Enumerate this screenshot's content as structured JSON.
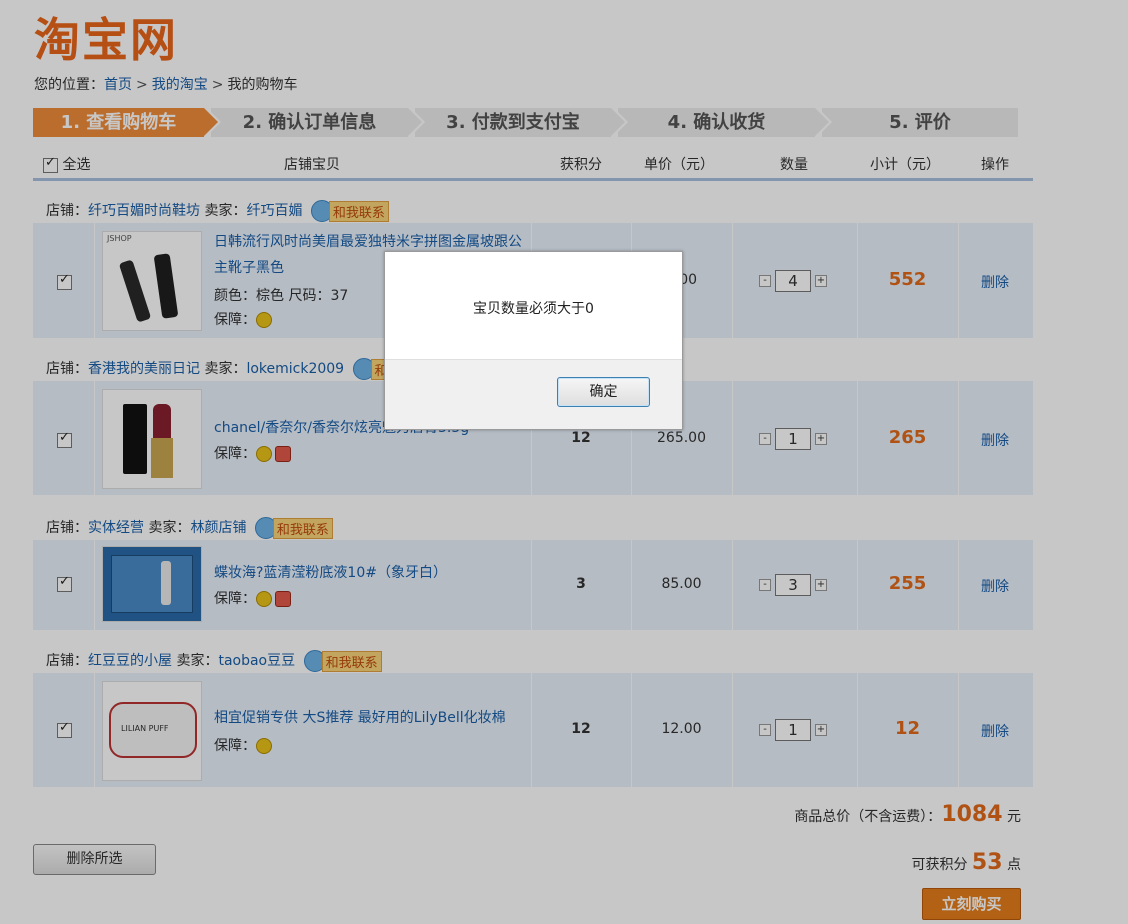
{
  "logo": "淘宝网",
  "breadcrumb": {
    "prefix": "您的位置：",
    "home": "首页",
    "my_taobao": "我的淘宝",
    "current": "我的购物车",
    "sep": ">"
  },
  "steps": [
    "1. 查看购物车",
    "2. 确认订单信息",
    "3. 付款到支付宝",
    "4. 确认收货",
    "5. 评价"
  ],
  "header": {
    "select_all": "全选",
    "item": "店铺宝贝",
    "points": "获积分",
    "unit_price": "单价（元）",
    "qty": "数量",
    "subtotal": "小计（元）",
    "action": "操作"
  },
  "labels": {
    "shop": "店铺：",
    "seller": "卖家：",
    "contact": "和我联系",
    "guard": "保障：",
    "delete": "删除",
    "minus": "-",
    "plus": "+"
  },
  "shops": [
    {
      "shop_name": "纤巧百媚时尚鞋坊",
      "seller": "纤巧百媚",
      "item": {
        "title": "日韩流行风时尚美眉最爱独特米字拼图金属坡跟公主靴子黑色",
        "attrs": "颜色：棕色 尺码：37",
        "points": "",
        "price": "3.00",
        "qty": "4",
        "subtotal": "552",
        "thumb_label": "JSHOP"
      }
    },
    {
      "shop_name": "香港我的美丽日记",
      "seller": "lokemick2009",
      "item": {
        "title": "chanel/香奈尔/香奈尔炫亮魅力唇膏3.5g",
        "attrs": "",
        "points": "12",
        "price": "265.00",
        "qty": "1",
        "subtotal": "265",
        "thumb_label": ""
      }
    },
    {
      "shop_name": "实体经营",
      "seller": "林颜店铺",
      "item": {
        "title": "蝶妆海?蓝清滢粉底液10#（象牙白）",
        "attrs": "",
        "points": "3",
        "price": "85.00",
        "qty": "3",
        "subtotal": "255",
        "thumb_label": ""
      }
    },
    {
      "shop_name": "红豆豆的小屋",
      "seller": "taobao豆豆",
      "item": {
        "title": "相宜促销专供 大S推荐 最好用的LilyBell化妆棉",
        "attrs": "",
        "points": "12",
        "price": "12.00",
        "qty": "1",
        "subtotal": "12",
        "thumb_label": "LILIAN PUFF"
      }
    }
  ],
  "summary": {
    "total_label": "商品总价（不含运费）：",
    "total": "1084",
    "total_unit": "元",
    "points_label": "可获积分",
    "points": "53",
    "points_unit": "点"
  },
  "buttons": {
    "delete_selected": "删除所选",
    "buy_now": "立刻购买"
  },
  "dialog": {
    "message": "宝贝数量必须大于0",
    "ok": "确定"
  },
  "colors": {
    "accent": "#e06a1a",
    "step_active": "#f08c3a",
    "row_bg": "#e9f1fb",
    "link": "#1a5fa8"
  }
}
